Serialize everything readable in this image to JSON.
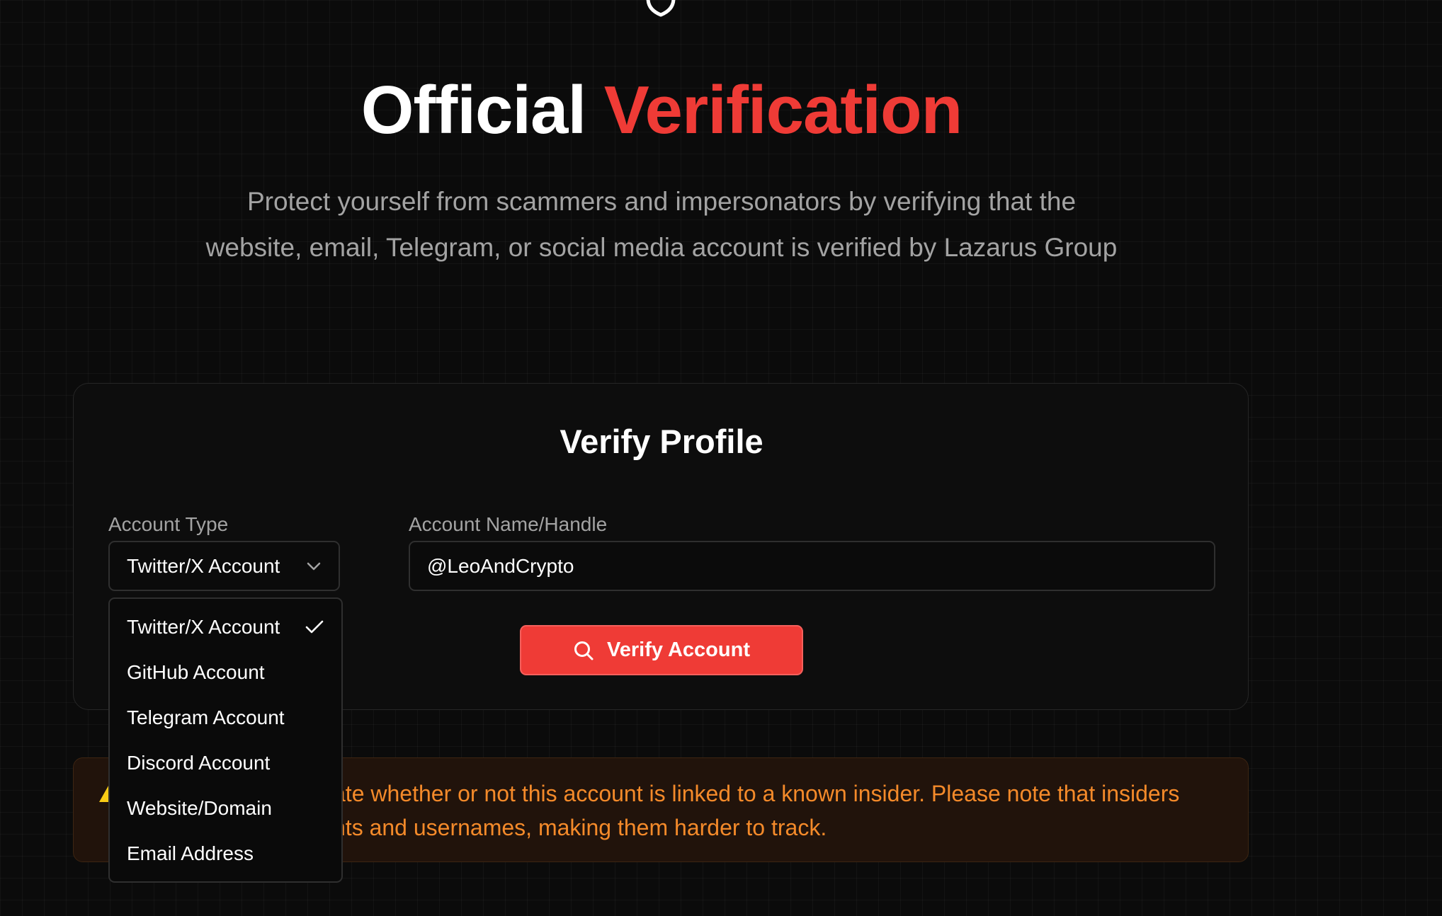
{
  "hero": {
    "title_main": "Official",
    "title_accent": "Verification",
    "subtitle": "Protect yourself from scammers and impersonators by verifying that the website, email, Telegram, or social media account is verified by Lazarus Group"
  },
  "card": {
    "title": "Verify Profile",
    "account_type_label": "Account Type",
    "account_type_selected": "Twitter/X Account",
    "account_name_label": "Account Name/Handle",
    "account_name_value": "@LeoAndCrypto",
    "verify_button_label": "Verify Account"
  },
  "dropdown": {
    "options": [
      {
        "label": "Twitter/X Account",
        "selected": true
      },
      {
        "label": "GitHub Account",
        "selected": false
      },
      {
        "label": "Telegram Account",
        "selected": false
      },
      {
        "label": "Discord Account",
        "selected": false
      },
      {
        "label": "Website/Domain",
        "selected": false
      },
      {
        "label": "Email Address",
        "selected": false
      }
    ]
  },
  "warning": {
    "line1": "ate whether or not this account is linked to a known insider. Please note that insiders",
    "line2": "nts and usernames, making them harder to track."
  },
  "icons": {
    "top": "shield-icon",
    "select": "chevron-down-icon",
    "check": "check-icon",
    "search": "search-icon",
    "warning": "warning-triangle-icon"
  },
  "colors": {
    "accent": "#ef3b36",
    "warning_text": "#f48a2a",
    "warning_bg": "#21130b",
    "background": "#0b0b0b"
  }
}
